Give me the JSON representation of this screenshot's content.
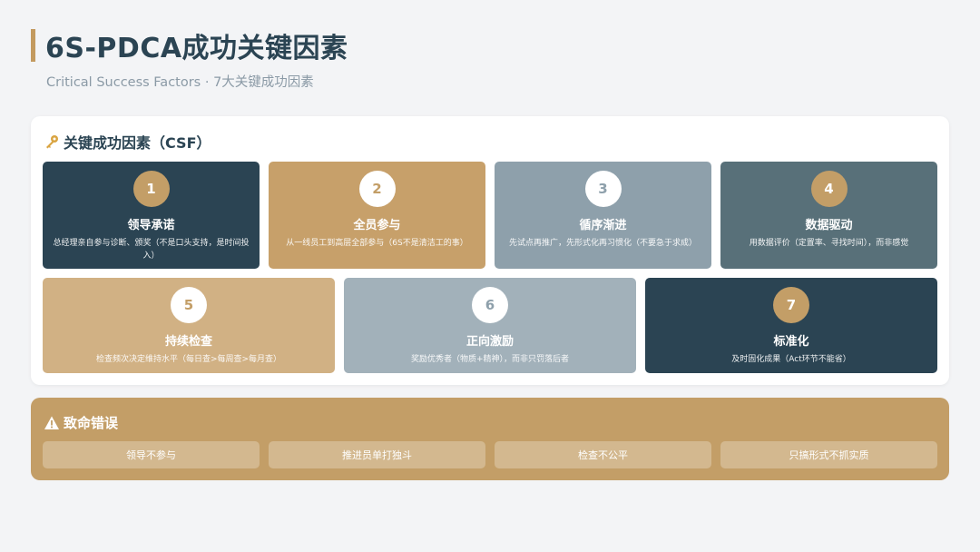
{
  "header": {
    "title": "6S-PDCA成功关键因素",
    "subtitle": "Critical Success Factors · 7大关键成功因素"
  },
  "csf": {
    "heading": "关键成功因素（CSF）",
    "icon": "key-icon",
    "cards": [
      {
        "num": "1",
        "title": "领导承诺",
        "desc": "总经理亲自参与诊断、颁奖（不是口头支持，是时间投入）"
      },
      {
        "num": "2",
        "title": "全员参与",
        "desc": "从一线员工到高层全部参与（6S不是清洁工的事）"
      },
      {
        "num": "3",
        "title": "循序渐进",
        "desc": "先试点再推广，先形式化再习惯化（不要急于求成）"
      },
      {
        "num": "4",
        "title": "数据驱动",
        "desc": "用数据评价（定置率、寻找时间），而非感觉"
      },
      {
        "num": "5",
        "title": "持续检查",
        "desc": "检查频次决定维持水平（每日查>每周查>每月查）"
      },
      {
        "num": "6",
        "title": "正向激励",
        "desc": "奖励优秀者（物质+精神），而非只罚落后者"
      },
      {
        "num": "7",
        "title": "标准化",
        "desc": "及时固化成果（Act环节不能省）"
      }
    ]
  },
  "errors": {
    "heading": "致命错误",
    "icon": "warning-icon",
    "items": [
      "领导不参与",
      "推进员单打独斗",
      "检查不公平",
      "只搞形式不抓实质"
    ]
  },
  "colors": {
    "navy": "#2b4453",
    "gold": "#c39e67",
    "gray_blue": "#8ea0ab",
    "slate": "#587079",
    "light_gold": "#d1b184",
    "light_gray": "#a2b1ba"
  }
}
